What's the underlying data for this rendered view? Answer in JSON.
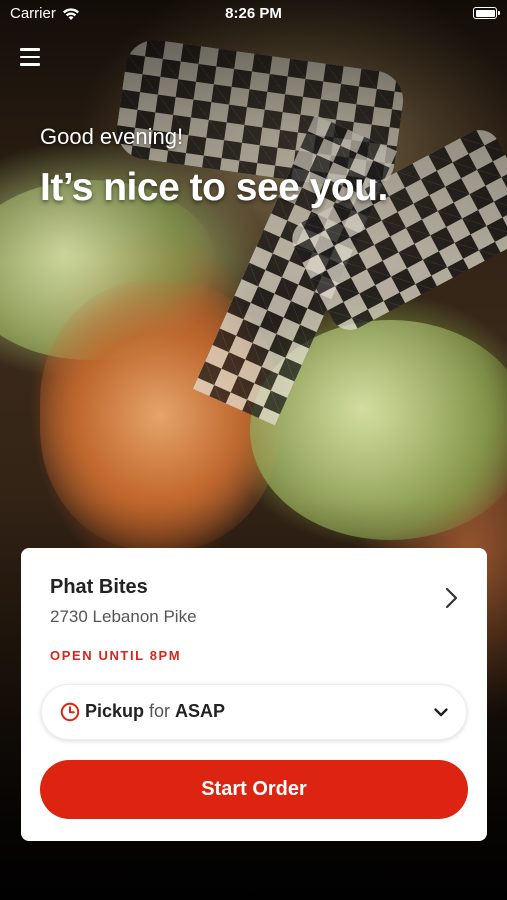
{
  "status_bar": {
    "carrier": "Carrier",
    "time": "8:26 PM",
    "icons": [
      "wifi-icon",
      "battery-icon"
    ]
  },
  "header": {
    "menu_icon": "hamburger-menu-icon",
    "greeting": "Good evening!",
    "headline": "It’s nice to see you."
  },
  "store_card": {
    "name": "Phat Bites",
    "address": "2730 Lebanon Pike",
    "hours": "OPEN UNTIL 8PM",
    "chevron_icon": "chevron-right-icon"
  },
  "order_mode": {
    "icon": "clock-icon",
    "mode": "Pickup",
    "connector": "for",
    "time": "ASAP",
    "dropdown_icon": "chevron-down-icon"
  },
  "cta": {
    "label": "Start Order"
  },
  "colors": {
    "accent": "#dd2410",
    "hours_text": "#d7261a",
    "card_background": "#ffffff"
  }
}
